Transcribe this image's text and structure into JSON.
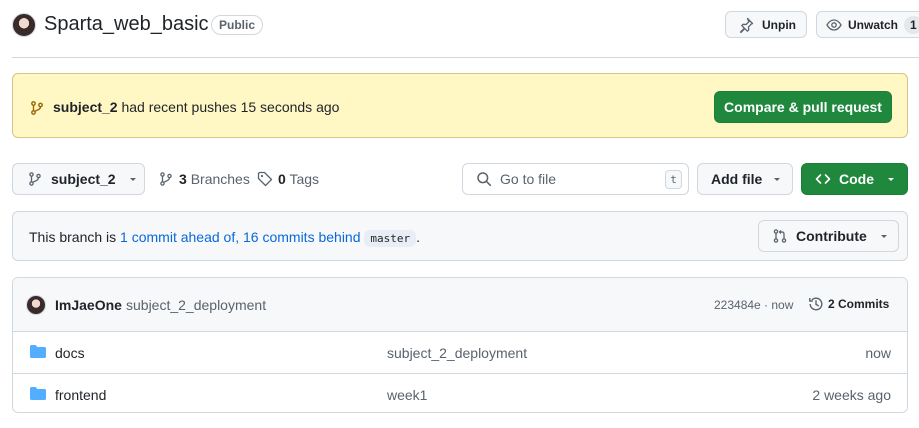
{
  "repo": {
    "name": "Sparta_web_basic",
    "visibility": "Public"
  },
  "actions": {
    "unpin_label": "Unpin",
    "unwatch_label": "Unwatch",
    "watch_count": "1"
  },
  "flash": {
    "branch": "subject_2",
    "message": "had recent pushes 15 seconds ago",
    "button_label": "Compare & pull request"
  },
  "toolbar": {
    "branch_label": "subject_2",
    "branches_count": "3",
    "branches_label": "Branches",
    "tags_count": "0",
    "tags_label": "Tags",
    "search_placeholder": "Go to file",
    "search_shortcut": "t",
    "add_file_label": "Add file",
    "code_label": "Code"
  },
  "branch_info": {
    "prefix": "This branch is",
    "ahead_link": "1 commit ahead of,",
    "behind_link": "16 commits behind",
    "base_branch": "master",
    "suffix": ".",
    "contribute_label": "Contribute"
  },
  "latest_commit": {
    "author": "ImJaeOne",
    "message": "subject_2_deployment",
    "sha_time": "223484e · now",
    "commits_label": "2 Commits"
  },
  "files": [
    {
      "name": "docs",
      "type": "folder",
      "commit_message": "subject_2_deployment",
      "age": "now"
    },
    {
      "name": "frontend",
      "type": "folder",
      "commit_message": "week1",
      "age": "2 weeks ago"
    }
  ],
  "colors": {
    "primary_green": "#1f883d",
    "link_blue": "#0969da",
    "flash_bg": "#fff8c5",
    "folder_blue": "#54aeff"
  }
}
